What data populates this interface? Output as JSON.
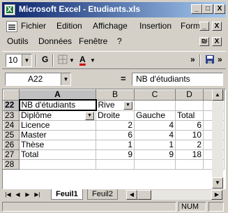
{
  "window": {
    "title": "Microsoft Excel - Etudiants.xls"
  },
  "title_buttons": {
    "minimize": "_",
    "maximize": "□",
    "close": "X"
  },
  "menu": {
    "row1": [
      "Fichier",
      "Edition",
      "Affichage",
      "Insertion",
      "Format"
    ],
    "row2": [
      "Outils",
      "Données",
      "Fenêtre",
      "?"
    ],
    "overflow": "»",
    "doc_buttons": {
      "minimize": "_",
      "restore": "₪",
      "close": "X"
    }
  },
  "toolbar": {
    "font_size": "10",
    "bold": "G",
    "font_color": "A",
    "overflow": "»",
    "overflow2": "»"
  },
  "formula_bar": {
    "name_box": "A22",
    "equals": "=",
    "content": "NB d'étudiants"
  },
  "grid": {
    "col_headers": [
      "",
      "A",
      "B",
      "C",
      "D"
    ],
    "rows": [
      {
        "num": "22",
        "cells": [
          "NB d'étudiants",
          "Rive",
          "",
          ""
        ]
      },
      {
        "num": "23",
        "cells": [
          "Diplôme",
          "Droite",
          "Gauche",
          "Total"
        ]
      },
      {
        "num": "24",
        "cells": [
          "Licence",
          "2",
          "4",
          "6"
        ]
      },
      {
        "num": "25",
        "cells": [
          "Master",
          "6",
          "4",
          "10"
        ]
      },
      {
        "num": "26",
        "cells": [
          "Thèse",
          "1",
          "1",
          "2"
        ]
      },
      {
        "num": "27",
        "cells": [
          "Total",
          "9",
          "9",
          "18"
        ]
      },
      {
        "num": "28",
        "cells": [
          "",
          "",
          "",
          ""
        ]
      }
    ]
  },
  "sheets": {
    "active": "Feuil1",
    "other": "Feuil2"
  },
  "status": {
    "num": "NUM"
  }
}
